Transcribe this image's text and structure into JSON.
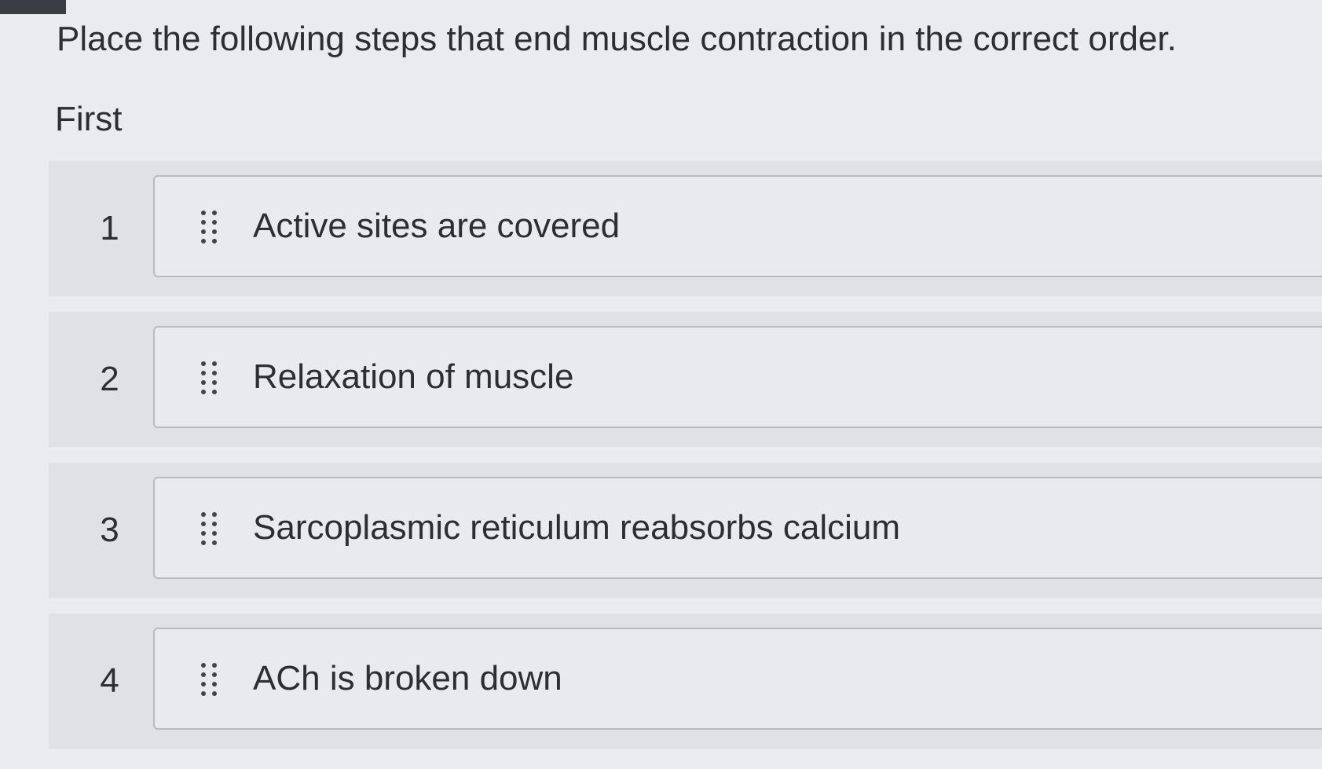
{
  "question": {
    "prompt": "Place the following steps that end muscle contraction in the correct order.",
    "order_label": "First"
  },
  "items": [
    {
      "position": "1",
      "text": "Active sites are covered",
      "handle_icon": "drag-handle-icon"
    },
    {
      "position": "2",
      "text": "Relaxation of muscle",
      "handle_icon": "drag-handle-icon"
    },
    {
      "position": "3",
      "text": "Sarcoplasmic reticulum reabsorbs calcium",
      "handle_icon": "drag-handle-icon"
    },
    {
      "position": "4",
      "text": "ACh is broken down",
      "handle_icon": "drag-handle-icon"
    }
  ],
  "colors": {
    "page_background": "#e9ebee",
    "row_background": "#dfe1e4",
    "item_border": "#b7bbc1",
    "text": "#2b2e33"
  }
}
